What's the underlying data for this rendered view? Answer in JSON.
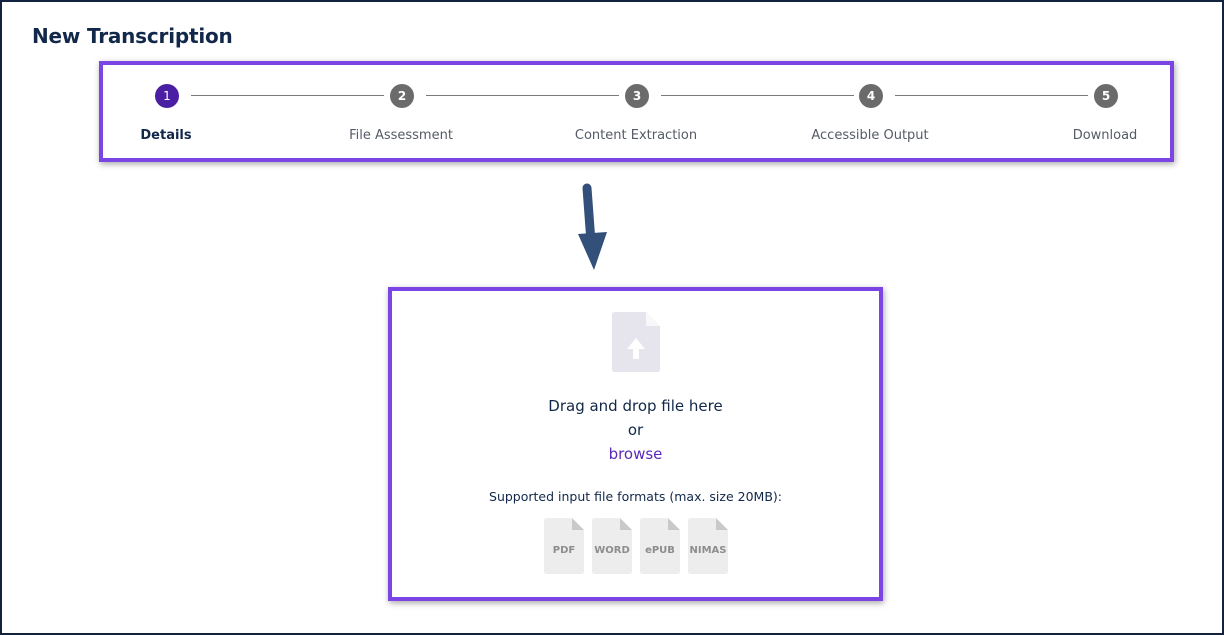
{
  "page": {
    "title": "New Transcription"
  },
  "stepper": {
    "active_index": 0,
    "steps": [
      {
        "number": "1",
        "label": "Details"
      },
      {
        "number": "2",
        "label": "File Assessment"
      },
      {
        "number": "3",
        "label": "Content Extraction"
      },
      {
        "number": "4",
        "label": "Accessible Output"
      },
      {
        "number": "5",
        "label": "Download"
      }
    ]
  },
  "upload": {
    "drag_text": "Drag and drop file here",
    "or_text": "or",
    "browse_label": "browse",
    "formats_text": "Supported input file formats (max. size 20MB):",
    "formats": [
      "PDF",
      "WORD",
      "ePUB",
      "NIMAS"
    ]
  },
  "colors": {
    "highlight_border": "#7b45e6",
    "active_step": "#4a1fa3",
    "inactive_step": "#6b6b6b",
    "arrow": "#33507a",
    "link": "#5a2bb8"
  }
}
